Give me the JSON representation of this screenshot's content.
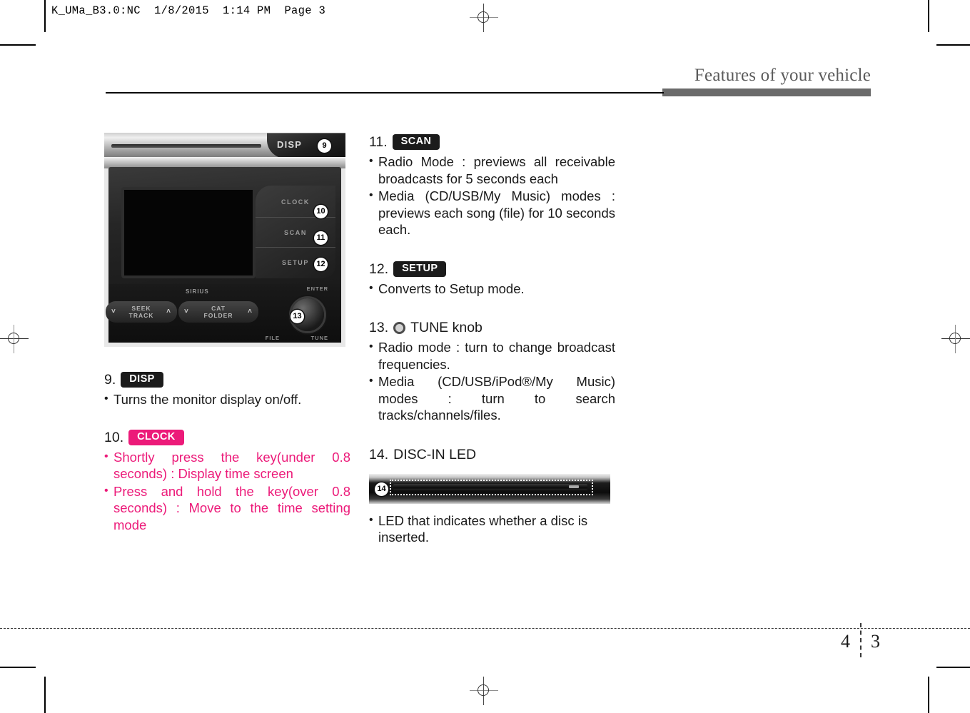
{
  "slug": {
    "text": "K_UMa_B3.0:NC  1/8/2015  1:14 PM  Page 3"
  },
  "running_head": {
    "title": "Features of your vehicle"
  },
  "colors": {
    "accent_pink": "#ec1a79",
    "badge_dark": "#1b1b1b",
    "head_gray": "#5b5b5b",
    "bar_gray": "#6b6b6b"
  },
  "radio_photo": {
    "name": "audio-head-unit-photo",
    "disp_button_label": "DISP",
    "keys": [
      "CLOCK",
      "SCAN",
      "SETUP"
    ],
    "brand_label": "SIRIUS",
    "rocker_left_line1": "SEEK",
    "rocker_left_line2": "TRACK",
    "rocker_right_line1": "CAT",
    "rocker_right_line2": "FOLDER",
    "micro_labels": {
      "enter": "ENTER",
      "tune": "TUNE",
      "file": "FILE"
    },
    "callouts": [
      "9",
      "10",
      "11",
      "12",
      "13"
    ]
  },
  "disc_photo": {
    "name": "disc-slot-photo",
    "callout": "14"
  },
  "items": [
    {
      "number": "9.",
      "badge": "DISP",
      "badge_style": "dark",
      "bullets": [
        "Turns the monitor display on/off."
      ],
      "text_style": "normal"
    },
    {
      "number": "10.",
      "badge": "CLOCK",
      "badge_style": "pink",
      "bullets": [
        "Shortly press the key(under 0.8 seconds) : Display time screen",
        "Press and hold the key(over 0.8 seconds) : Move to the time setting mode"
      ],
      "text_style": "pink"
    },
    {
      "number": "11.",
      "badge": "SCAN",
      "badge_style": "dark",
      "bullets": [
        "Radio Mode : previews all receivable broadcasts for 5 seconds each",
        "Media (CD/USB/My Music) modes : previews each song (file) for 10 seconds each."
      ],
      "text_style": "normal"
    },
    {
      "number": "12.",
      "badge": "SETUP",
      "badge_style": "dark",
      "bullets": [
        "Converts to Setup mode."
      ],
      "text_style": "normal"
    },
    {
      "number": "13.",
      "icon": "tune-knob-icon",
      "label": "TUNE knob",
      "bullets": [
        "Radio mode : turn to change broadcast frequencies.",
        "Media  (CD/USB/iPod®/My  Music) modes : turn to search tracks/channels/files."
      ],
      "text_style": "normal"
    },
    {
      "number": "14.",
      "label": "DISC-IN LED",
      "bullets": [
        "LED that indicates whether a disc is inserted."
      ],
      "text_style": "normal"
    }
  ],
  "footer": {
    "page_left": "4",
    "page_right": "3"
  }
}
